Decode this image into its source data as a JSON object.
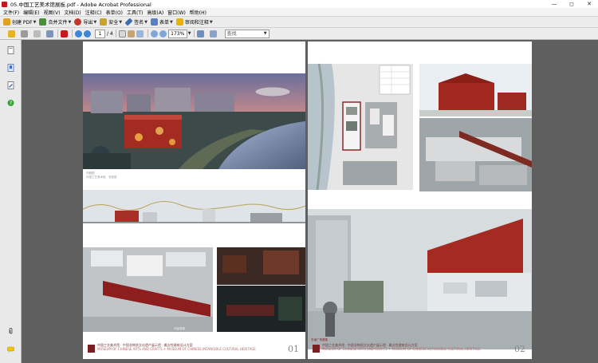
{
  "window": {
    "title": "05.中国工艺美术馆展板.pdf - Adobe Acrobat Professional",
    "controls": [
      "—",
      "◻",
      "✕"
    ]
  },
  "menu": [
    "文件(F)",
    "编辑(E)",
    "视图(V)",
    "文档(D)",
    "注释(C)",
    "表单(O)",
    "工具(T)",
    "高级(A)",
    "窗口(W)",
    "帮助(H)"
  ],
  "toolbar1": {
    "create_pdf": "创建 PDF",
    "combine": "合并文件",
    "export": "导出",
    "secure": "安全",
    "sign": "签名",
    "forms": "表单",
    "review": "审阅和注释"
  },
  "toolbar2": {
    "page_current": "1",
    "page_total": "/ 4",
    "zoom": "173%",
    "find_placeholder": "查找"
  },
  "pages": [
    {
      "number": "01",
      "caption1": "鸟瞰图",
      "caption1_sub": "中国工艺美术馆 · 非遗馆",
      "caption2": "内部透视",
      "footer_cn": "中国工艺美术馆 · 中国非物质文化遗产展示馆 · 概念性建筑设计方案",
      "footer_en": "MUSEUM OF CHINESE ARTS AND CRAFTS + MUSEUM OF CHINESE INTANGIBLE CULTURAL HERITAGE"
    },
    {
      "number": "02",
      "caption1": "东南广场透视",
      "footer_cn": "中国工艺美术馆 · 中国非物质文化遗产展示馆 · 概念性建筑设计方案",
      "footer_en": "MUSEUM OF CHINESE ARTS AND CRAFTS + MUSEUM OF CHINESE INTANGIBLE CULTURAL HERITAGE"
    }
  ],
  "colors": {
    "brand_red": "#b3302a",
    "acrobat_red": "#c8161d",
    "doc_bg": "#5f5f5f"
  }
}
